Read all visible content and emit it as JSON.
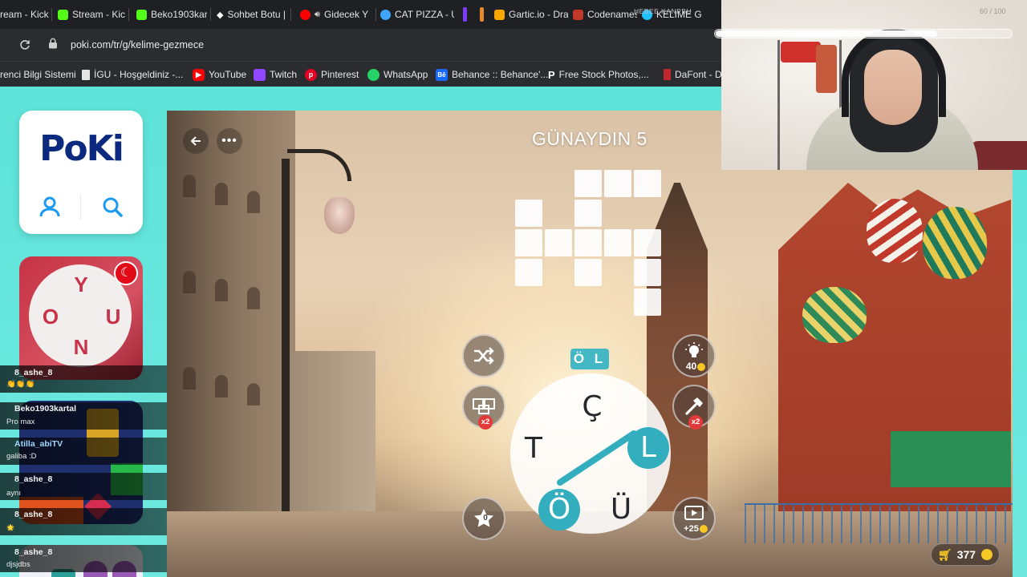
{
  "browser": {
    "tabs": [
      {
        "label": "ream - Kick",
        "icon": "kick-icon",
        "color": "#53fc18"
      },
      {
        "label": "Stream - Kick",
        "icon": "kick-icon",
        "color": "#53fc18"
      },
      {
        "label": "Beko1903kart",
        "icon": "kick-icon",
        "color": "#53fc18"
      },
      {
        "label": "Sohbet Botu |",
        "icon": "bot-icon",
        "color": "#ffffff"
      },
      {
        "label": "Gidecek Y",
        "icon": "youtube-icon",
        "color": "#ff0000"
      },
      {
        "label": "CAT PIZZA - U",
        "icon": "cat-pizza-icon",
        "color": "#3ea6ff"
      },
      {
        "label": "Gartic.io - Dra",
        "icon": "gartic-icon",
        "color": "#f7a600"
      },
      {
        "label": "Codenames",
        "icon": "codenames-icon",
        "color": "#c0392b"
      },
      {
        "label": "KELIME G",
        "icon": "poki-icon",
        "color": "#1fc1ff"
      }
    ],
    "tab_overlay_text": "HEBEE KANPBU",
    "url": "poki.com/tr/g/kelime-gezmece",
    "bookmarks": [
      {
        "label": "renci Bilgi Sistemi",
        "icon": "",
        "color": ""
      },
      {
        "label": "İGU - Hoşgeldiniz -...",
        "icon": "document-icon",
        "color": "#dddddd"
      },
      {
        "label": "YouTube",
        "icon": "youtube-icon",
        "color": "#ff0000"
      },
      {
        "label": "Twitch",
        "icon": "twitch-icon",
        "color": "#9146ff"
      },
      {
        "label": "Pinterest",
        "icon": "pinterest-icon",
        "color": "#e60023"
      },
      {
        "label": "WhatsApp",
        "icon": "whatsapp-icon",
        "color": "#25d366"
      },
      {
        "label": "Behance :: Behance'...",
        "icon": "behance-icon",
        "color": "#1769ff"
      },
      {
        "label": "Free Stock Photos,...",
        "icon": "pexels-icon",
        "color": "#ffffff"
      },
      {
        "label": "DaFont - D",
        "icon": "dafont-icon",
        "color": "#c1272d"
      }
    ]
  },
  "sidebar": {
    "logo": "PoKi",
    "thumb_letters": [
      "Y",
      "O",
      "U",
      "N"
    ]
  },
  "chat": [
    {
      "user": "8_ashe_8",
      "message": "👏👏👏"
    },
    {
      "user": "Beko1903kartal",
      "message": "Pro max"
    },
    {
      "user": "Atilla_abiTV",
      "message": "galiba :D"
    },
    {
      "user": "8_ashe_8",
      "message": "aynı"
    },
    {
      "user": "8_ashe_8",
      "message": "🌟"
    },
    {
      "user": "8_ashe_8",
      "message": "djsjdbs"
    }
  ],
  "game": {
    "level_title": "GÜNAYDIN 5",
    "current_word": "Ö L",
    "wheel_letters": [
      "Ç",
      "T",
      "L",
      "Ö",
      "Ü"
    ],
    "shuffle_label": "shuffle",
    "double_badge": "x2",
    "hint_cost": "40",
    "hammer_badge": "x2",
    "star_count": "0",
    "video_reward": "+25",
    "coins": "377"
  },
  "webcam": {
    "overlay_text": "60 / 100",
    "volume_fraction": 0.75
  }
}
